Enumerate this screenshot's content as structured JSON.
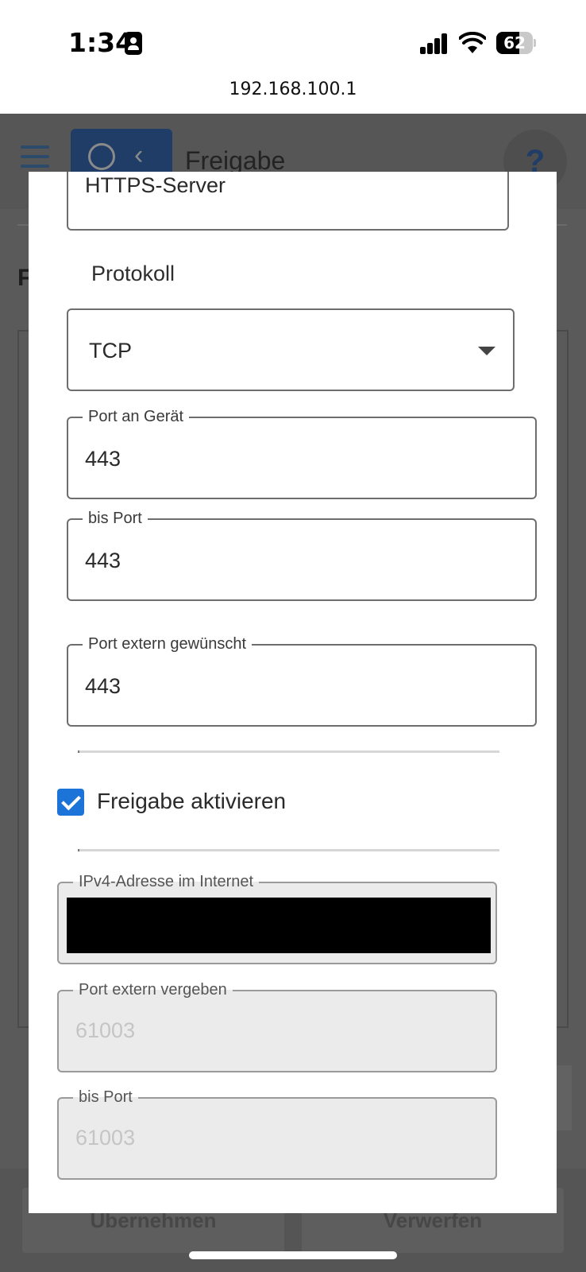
{
  "status_bar": {
    "time": "1:34",
    "battery_level": "62",
    "url": "192.168.100.1"
  },
  "background": {
    "header_title": "Freigabe",
    "help": "?",
    "section_letter": "F",
    "apply_button": "Übernehmen",
    "discard_button": "Verwerfen"
  },
  "dialog": {
    "name_value": "HTTPS-Server",
    "protocol_label": "Protokoll",
    "protocol_value": "TCP",
    "port_device": {
      "label": "Port an Gerät",
      "value": "443"
    },
    "bis_port": {
      "label": "bis Port",
      "value": "443"
    },
    "port_extern_requested": {
      "label": "Port extern gewünscht",
      "value": "443"
    },
    "activate": {
      "label": "Freigabe aktivieren",
      "checked": true
    },
    "ipv4": {
      "label": "IPv4-Adresse im Internet"
    },
    "port_extern_assigned": {
      "label": "Port extern vergeben",
      "value": "61003"
    },
    "bis_port_assigned": {
      "label": "bis Port",
      "value": "61003"
    }
  },
  "colors": {
    "accent": "#1d74d8",
    "brand_dark": "#1f3d66",
    "overlay": "#5a5a5a",
    "disabled_field": "#ebebeb"
  }
}
